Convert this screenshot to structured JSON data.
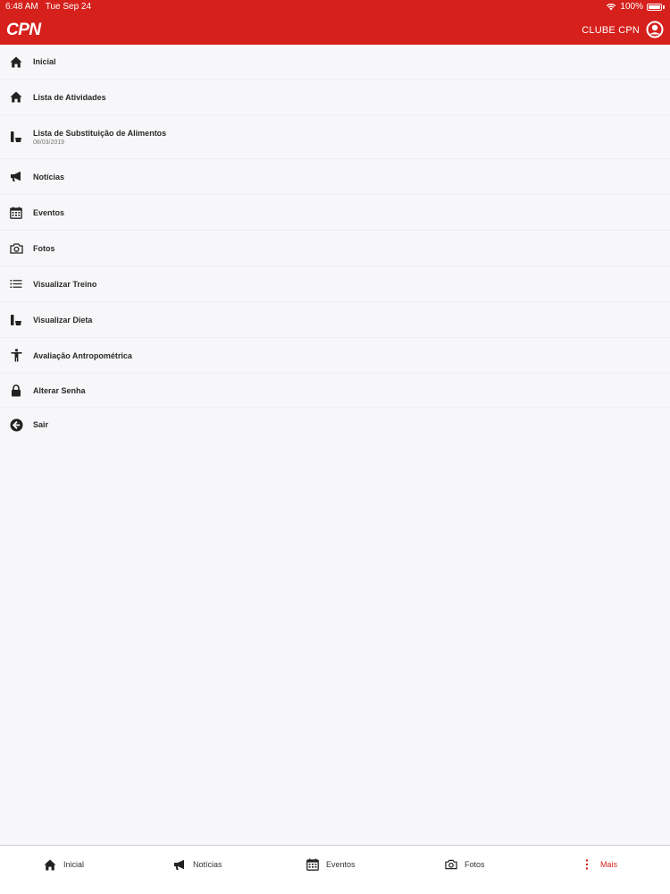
{
  "status_bar": {
    "time": "6:48 AM",
    "date": "Tue Sep 24",
    "battery": "100%"
  },
  "header": {
    "logo": "CPN",
    "club_label": "CLUBE CPN"
  },
  "menu": {
    "items": [
      {
        "label": "Inicial",
        "icon": "home-icon"
      },
      {
        "label": "Lista de Atividades",
        "icon": "home-icon"
      },
      {
        "label": "Lista de Substituição de Alimentos",
        "sub": "08/03/2019",
        "icon": "diet-icon"
      },
      {
        "label": "Notícias",
        "icon": "megaphone-icon"
      },
      {
        "label": "Eventos",
        "icon": "calendar-icon"
      },
      {
        "label": "Fotos",
        "icon": "camera-icon"
      },
      {
        "label": "Visualizar Treino",
        "icon": "list-icon"
      },
      {
        "label": "Visualizar Dieta",
        "icon": "diet-icon"
      },
      {
        "label": "Avaliação Antropométrica",
        "icon": "person-icon"
      },
      {
        "label": "Alterar Senha",
        "icon": "lock-icon"
      },
      {
        "label": "Sair",
        "icon": "arrow-left-circle-icon"
      }
    ]
  },
  "tabbar": {
    "tabs": [
      {
        "label": "Inicial",
        "icon": "home-icon"
      },
      {
        "label": "Notícias",
        "icon": "megaphone-icon"
      },
      {
        "label": "Eventos",
        "icon": "calendar-icon"
      },
      {
        "label": "Fotos",
        "icon": "camera-icon"
      },
      {
        "label": "Mais",
        "icon": "more-vertical-icon",
        "active": true
      }
    ]
  },
  "colors": {
    "brand": "#d6201c",
    "background": "#f7f7f9"
  }
}
